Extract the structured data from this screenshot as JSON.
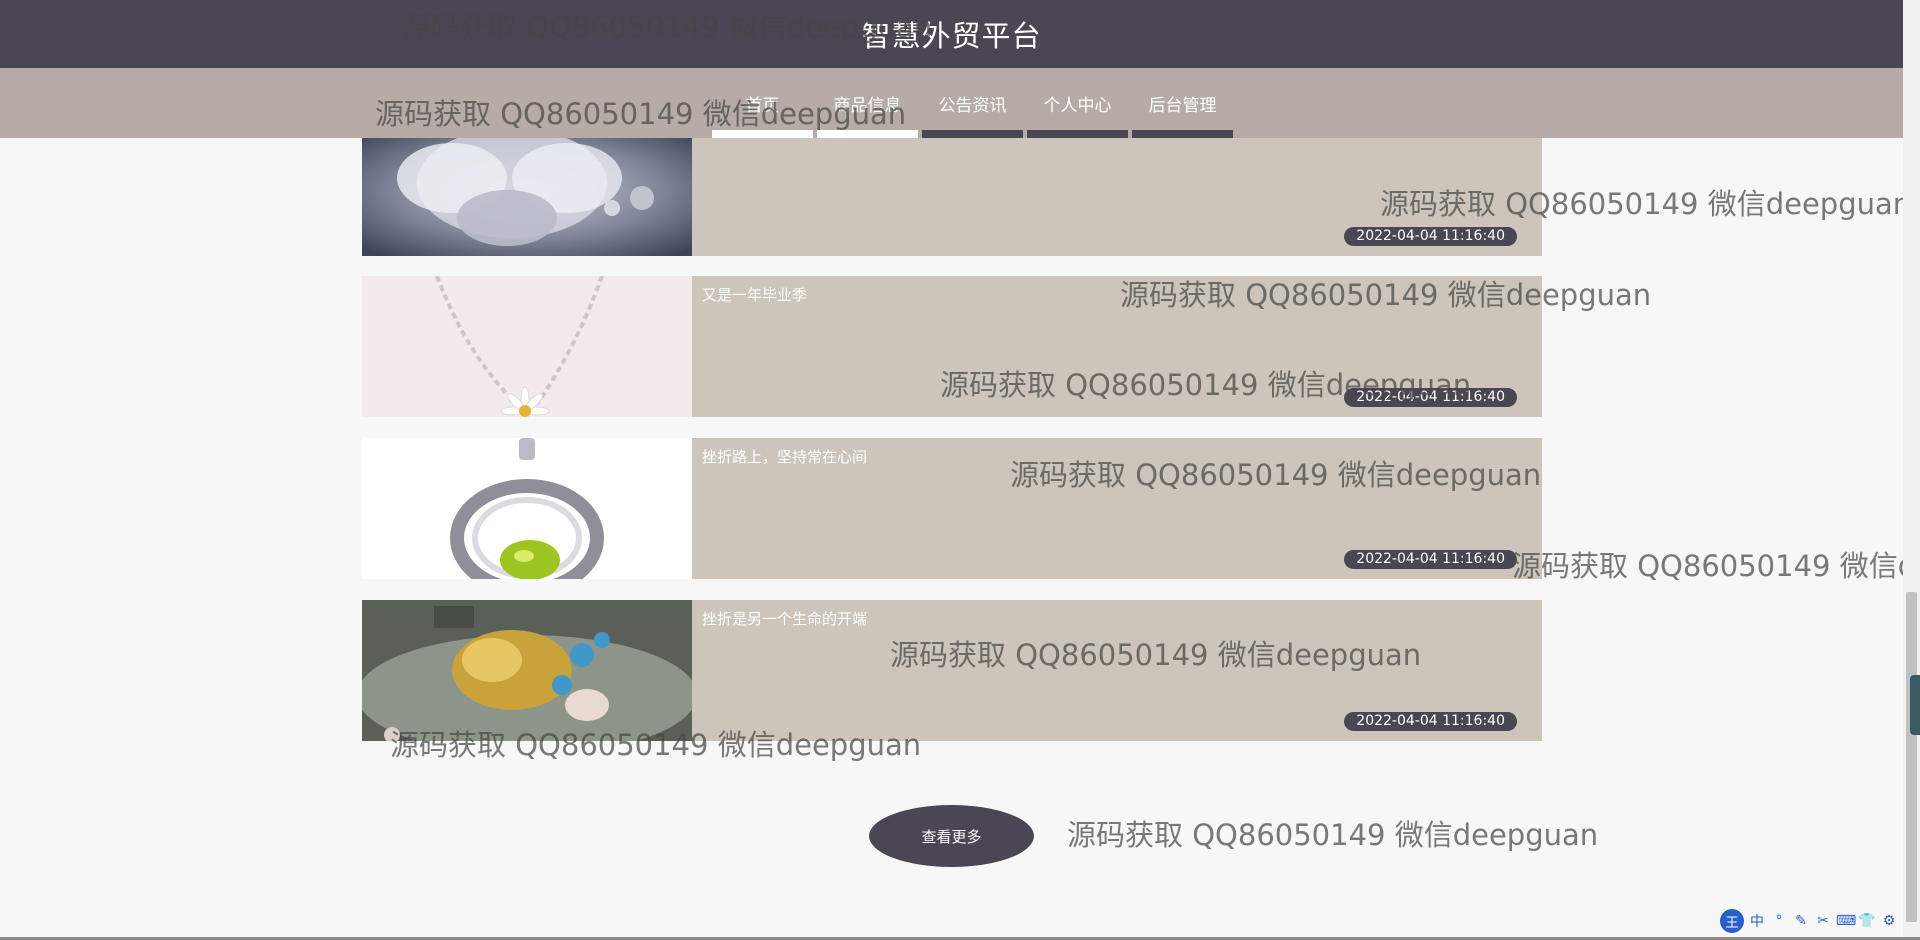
{
  "header": {
    "site_title": "智慧外贸平台"
  },
  "nav": {
    "items": [
      {
        "label": "首页"
      },
      {
        "label": "商品信息"
      },
      {
        "label": "公告资讯"
      },
      {
        "label": "个人中心"
      },
      {
        "label": "后台管理"
      }
    ]
  },
  "news": {
    "items": [
      {
        "title": "",
        "date": "2022-04-04 11:16:40",
        "thumb": "butterfly-brooch"
      },
      {
        "title": "又是一年毕业季",
        "date": "2022-04-04 11:16:40",
        "thumb": "daisy-necklace"
      },
      {
        "title": "挫折路上，坚持常在心间",
        "date": "2022-04-04 11:16:40",
        "thumb": "peridot-pendant"
      },
      {
        "title": "挫折是另一个生命的开端",
        "date": "2022-04-04 11:16:40",
        "thumb": "gold-hairpin"
      }
    ],
    "more_label": "查看更多"
  },
  "watermark": {
    "text": "源码获取 QQ86050149 微信deepguan"
  },
  "ime": {
    "logo": "王",
    "buttons": [
      "中",
      "°",
      "✎",
      "✂",
      "⌨",
      "👕",
      "⚙"
    ]
  },
  "colors": {
    "header_bg": "#4b4653",
    "nav_bg": "#b6aca5",
    "card_bg": "#cdc5bb",
    "accent": "#4b4653"
  }
}
